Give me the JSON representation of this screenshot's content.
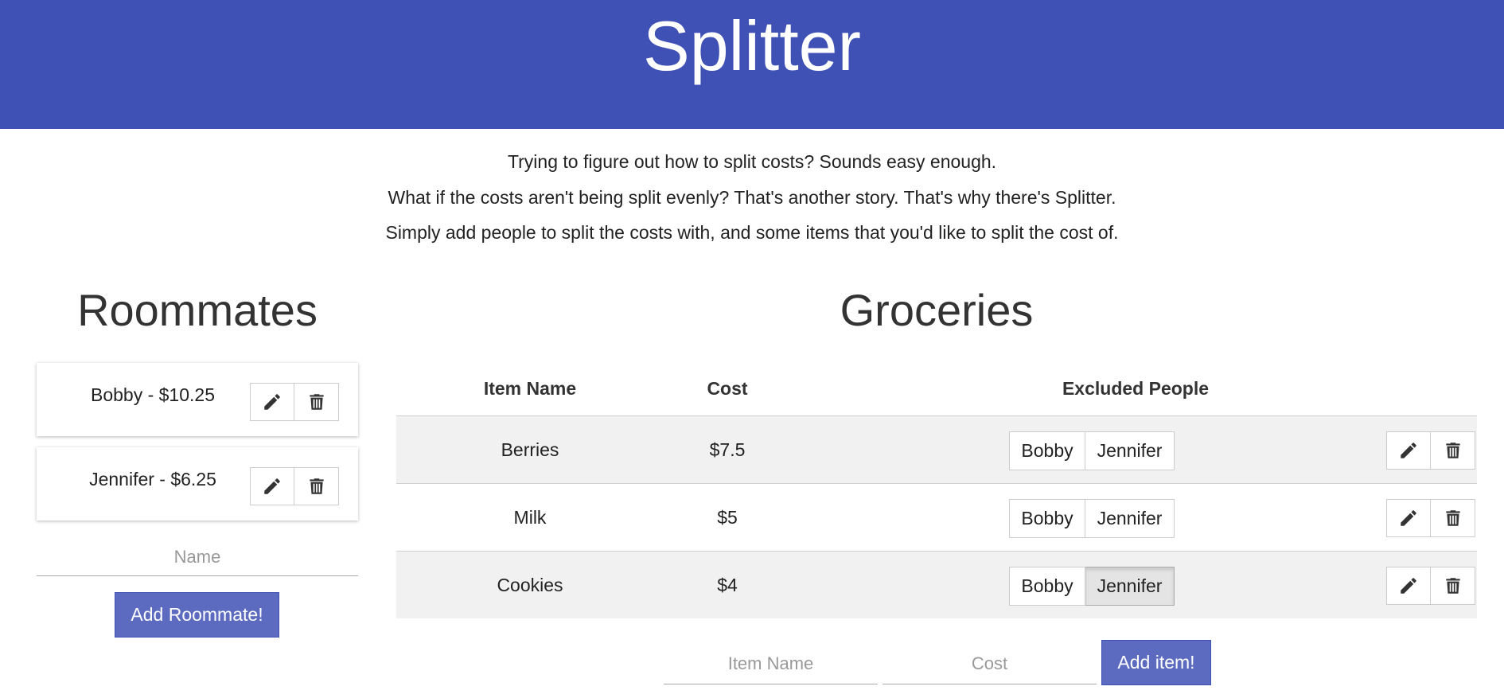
{
  "app": {
    "title": "Splitter"
  },
  "intro": [
    "Trying to figure out how to split costs? Sounds easy enough.",
    "What if the costs aren't being split evenly? That's another story. That's why there's Splitter.",
    "Simply add people to split the costs with, and some items that you'd like to split the cost of."
  ],
  "colors": {
    "header": "#3f51b5",
    "button": "#5c6bc0"
  },
  "roommates": {
    "title": "Roommates",
    "items": [
      {
        "label": "Bobby - $10.25"
      },
      {
        "label": "Jennifer - $6.25"
      }
    ],
    "name_placeholder": "Name",
    "add_label": "Add Roommate!"
  },
  "groceries": {
    "title": "Groceries",
    "headers": {
      "name": "Item Name",
      "cost": "Cost",
      "excluded": "Excluded People"
    },
    "rows": [
      {
        "name": "Berries",
        "cost": "$7.5",
        "people": [
          "Bobby",
          "Jennifer"
        ],
        "excluded": []
      },
      {
        "name": "Milk",
        "cost": "$5",
        "people": [
          "Bobby",
          "Jennifer"
        ],
        "excluded": []
      },
      {
        "name": "Cookies",
        "cost": "$4",
        "people": [
          "Bobby",
          "Jennifer"
        ],
        "excluded": [
          "Jennifer"
        ]
      }
    ],
    "item_placeholder": "Item Name",
    "cost_placeholder": "Cost",
    "add_label": "Add item!"
  },
  "icons": {
    "edit": "pencil-icon",
    "delete": "trash-icon"
  }
}
